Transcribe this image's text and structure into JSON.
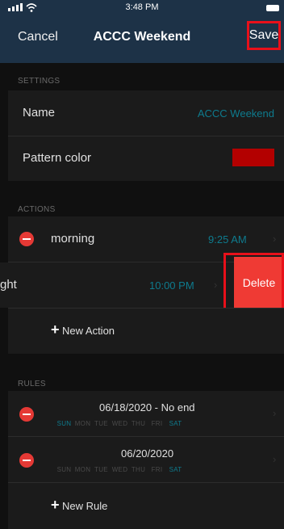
{
  "status_bar": {
    "time": "3:48 PM"
  },
  "nav": {
    "cancel": "Cancel",
    "title": "ACCC Weekend",
    "save": "Save"
  },
  "settings": {
    "header": "SETTINGS",
    "name_label": "Name",
    "name_value": "ACCC Weekend",
    "pattern_color_label": "Pattern color",
    "pattern_color_swatch": "#b30000"
  },
  "actions": {
    "header": "ACTIONS",
    "items": [
      {
        "label": "morning",
        "time": "9:25 AM"
      },
      {
        "label": "ght",
        "time": "10:00 PM"
      }
    ],
    "delete_label": "Delete",
    "new_action": "New Action"
  },
  "rules": {
    "header": "RULES",
    "items": [
      {
        "title": "06/18/2020 - No end",
        "days": [
          {
            "d": "SUN",
            "on": true
          },
          {
            "d": "MON",
            "on": false
          },
          {
            "d": "TUE",
            "on": false
          },
          {
            "d": "WED",
            "on": false
          },
          {
            "d": "THU",
            "on": false
          },
          {
            "d": "FRI",
            "on": false
          },
          {
            "d": "SAT",
            "on": true
          }
        ]
      },
      {
        "title": "06/20/2020",
        "days": [
          {
            "d": "SUN",
            "on": false
          },
          {
            "d": "MON",
            "on": false
          },
          {
            "d": "TUE",
            "on": false
          },
          {
            "d": "WED",
            "on": false
          },
          {
            "d": "THU",
            "on": false
          },
          {
            "d": "FRI",
            "on": false
          },
          {
            "d": "SAT",
            "on": true
          }
        ]
      }
    ],
    "new_rule": "New Rule"
  },
  "colors": {
    "nav_bg": "#1d3247",
    "accent": "#0e7b8e",
    "destructive": "#ef3a34",
    "highlight": "#e8101a"
  }
}
